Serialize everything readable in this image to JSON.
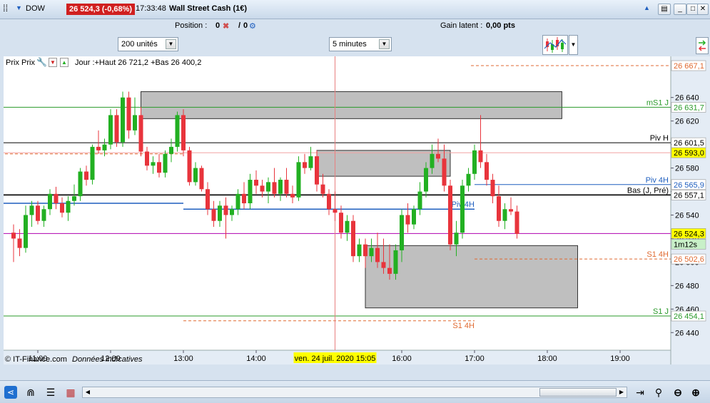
{
  "titlebar": {
    "symbol": "DOW",
    "price_badge": "26 524,3 (-0,68%)",
    "time": "17:33:48",
    "instrument": "Wall Street Cash (1€)"
  },
  "infobar": {
    "position_label": "Position :",
    "position_value": "0",
    "position_value2": "0",
    "gain_label": "Gain latent :",
    "gain_value": "0,00 pts"
  },
  "toolbar": {
    "units_value": "200 unités",
    "timeframe_value": "5 minutes"
  },
  "chart_header": {
    "label": "Prix Prix",
    "summary": "Jour :+Haut 26 721,2 +Bas 26 400,2"
  },
  "chart_footer": {
    "copyright": "© IT-Finance.com",
    "note": "Données indicatives"
  },
  "colors": {
    "up": "#22b022",
    "down": "#e8343c",
    "grid_bg": "#ffffff",
    "badge_red": "#d02020",
    "price_line": "#b000b0",
    "blue_level": "#1f5fbf",
    "green_level": "#2a9a2a",
    "orange_level": "#e06a30",
    "zone_fill": "#aaaaaa"
  },
  "chart_data": {
    "type": "candlestick",
    "ylim": [
      26425,
      26675
    ],
    "y_ticks": [
      26440,
      26460,
      26480,
      26500,
      26520,
      26540,
      26560,
      26580,
      26600,
      26620,
      26640
    ],
    "y_tick_labels": [
      "26 440",
      "26 460",
      "26 480",
      "26 500",
      "26 520",
      "26 540",
      "26 560",
      "26 580",
      "26 600",
      "26 620",
      "26 640"
    ],
    "x_ticks": [
      {
        "label": "11:00",
        "min": 660
      },
      {
        "label": "12:00",
        "min": 720
      },
      {
        "label": "13:00",
        "min": 780
      },
      {
        "label": "14:00",
        "min": 840
      },
      {
        "label": "16:00",
        "min": 960
      },
      {
        "label": "17:00",
        "min": 1020
      },
      {
        "label": "18:00",
        "min": 1080
      },
      {
        "label": "19:00",
        "min": 1140
      }
    ],
    "cursor": {
      "min": 905,
      "label": "ven. 24 juil. 2020 15:05"
    },
    "levels": [
      {
        "name": "mS1 J",
        "value": 26631.7,
        "label": "26 631,7",
        "color": "#2a9a2a",
        "from": 0,
        "dash": false,
        "badge_bg": "#ffffff",
        "badge_fg": "#2a9a2a"
      },
      {
        "name": "Piv H",
        "value": 26601.5,
        "label": "26 601,5",
        "color": "#000000",
        "from": 0,
        "dash": false,
        "badge_bg": "#ffffff",
        "badge_fg": "#000000"
      },
      {
        "name": "",
        "value": 26593.0,
        "label": "26 593,0",
        "color": "#f0a0a0",
        "from": 0,
        "dash": false,
        "badge_bg": "#ffff00",
        "badge_fg": "#000000"
      },
      {
        "name": "Piv 4H",
        "value": 26565.9,
        "label": "26 565,9",
        "color": "#1f5fbf",
        "from": 1020,
        "dash": false,
        "badge_bg": "#ffffff",
        "badge_fg": "#1f5fbf"
      },
      {
        "name": "Bas (J, Pré)",
        "value": 26557.1,
        "label": "26 557,1",
        "color": "#000000",
        "from": 0,
        "dash": false,
        "badge_bg": "#ffffff",
        "badge_fg": "#000000",
        "thick": true
      },
      {
        "name": "",
        "value": 26524.3,
        "label": "26 524,3",
        "color": "#b000b0",
        "from": 0,
        "dash": false,
        "badge_bg": "#ffff00",
        "badge_fg": "#000000"
      },
      {
        "name": "S1 4H",
        "value": 26502.6,
        "label": "26 502,6",
        "color": "#e06a30",
        "from": 1020,
        "dash": true,
        "badge_bg": "#ffffff",
        "badge_fg": "#e06a30"
      },
      {
        "name": "S1 J",
        "value": 26454.1,
        "label": "26 454,1",
        "color": "#2a9a2a",
        "from": 0,
        "dash": false,
        "badge_bg": "#ffffff",
        "badge_fg": "#2a9a2a"
      }
    ],
    "top_level": {
      "value": 26667.1,
      "label": "26 667,1"
    },
    "countdown": "1m12s",
    "segments": [
      {
        "name": "",
        "value": 26550,
        "from": 600,
        "to": 780,
        "color": "#1f5fbf"
      },
      {
        "name": "Piv 4H",
        "value": 26545,
        "from": 780,
        "to": 1020,
        "color": "#1f5fbf",
        "dash": false
      },
      {
        "name": "S1 4H",
        "value": 26450,
        "from": 780,
        "to": 1020,
        "color": "#e06a30",
        "dash": true
      },
      {
        "name": "",
        "value": 26592,
        "from": 600,
        "to": 780,
        "color": "#e06a30",
        "dash": true
      }
    ],
    "zones": [
      {
        "from": 745,
        "to": 1092,
        "top": 26645,
        "bottom": 26622
      },
      {
        "from": 890,
        "to": 1000,
        "top": 26595,
        "bottom": 26573
      },
      {
        "from": 930,
        "to": 1105,
        "top": 26514,
        "bottom": 26461
      }
    ],
    "candles": [
      {
        "t": 640,
        "o": 26525,
        "h": 26532,
        "l": 26500,
        "c": 26520
      },
      {
        "t": 645,
        "o": 26520,
        "h": 26528,
        "l": 26505,
        "c": 26512
      },
      {
        "t": 650,
        "o": 26512,
        "h": 26548,
        "l": 26508,
        "c": 26540
      },
      {
        "t": 655,
        "o": 26540,
        "h": 26552,
        "l": 26530,
        "c": 26548
      },
      {
        "t": 660,
        "o": 26548,
        "h": 26552,
        "l": 26532,
        "c": 26535
      },
      {
        "t": 665,
        "o": 26535,
        "h": 26548,
        "l": 26530,
        "c": 26545
      },
      {
        "t": 670,
        "o": 26545,
        "h": 26562,
        "l": 26540,
        "c": 26558
      },
      {
        "t": 675,
        "o": 26558,
        "h": 26564,
        "l": 26545,
        "c": 26550
      },
      {
        "t": 680,
        "o": 26550,
        "h": 26555,
        "l": 26538,
        "c": 26542
      },
      {
        "t": 685,
        "o": 26542,
        "h": 26556,
        "l": 26535,
        "c": 26552
      },
      {
        "t": 690,
        "o": 26552,
        "h": 26566,
        "l": 26548,
        "c": 26556
      },
      {
        "t": 695,
        "o": 26556,
        "h": 26580,
        "l": 26552,
        "c": 26577
      },
      {
        "t": 700,
        "o": 26577,
        "h": 26582,
        "l": 26565,
        "c": 26570
      },
      {
        "t": 705,
        "o": 26570,
        "h": 26600,
        "l": 26566,
        "c": 26598
      },
      {
        "t": 710,
        "o": 26598,
        "h": 26612,
        "l": 26592,
        "c": 26595
      },
      {
        "t": 715,
        "o": 26595,
        "h": 26605,
        "l": 26590,
        "c": 26600
      },
      {
        "t": 720,
        "o": 26600,
        "h": 26630,
        "l": 26596,
        "c": 26625
      },
      {
        "t": 725,
        "o": 26625,
        "h": 26630,
        "l": 26598,
        "c": 26602
      },
      {
        "t": 730,
        "o": 26602,
        "h": 26645,
        "l": 26598,
        "c": 26640
      },
      {
        "t": 735,
        "o": 26640,
        "h": 26645,
        "l": 26605,
        "c": 26612
      },
      {
        "t": 740,
        "o": 26612,
        "h": 26640,
        "l": 26608,
        "c": 26625
      },
      {
        "t": 745,
        "o": 26625,
        "h": 26632,
        "l": 26590,
        "c": 26594
      },
      {
        "t": 750,
        "o": 26594,
        "h": 26598,
        "l": 26578,
        "c": 26582
      },
      {
        "t": 755,
        "o": 26582,
        "h": 26590,
        "l": 26575,
        "c": 26585
      },
      {
        "t": 760,
        "o": 26585,
        "h": 26592,
        "l": 26572,
        "c": 26576
      },
      {
        "t": 765,
        "o": 26576,
        "h": 26595,
        "l": 26572,
        "c": 26592
      },
      {
        "t": 770,
        "o": 26592,
        "h": 26605,
        "l": 26585,
        "c": 26598
      },
      {
        "t": 775,
        "o": 26598,
        "h": 26628,
        "l": 26594,
        "c": 26625
      },
      {
        "t": 780,
        "o": 26625,
        "h": 26630,
        "l": 26590,
        "c": 26595
      },
      {
        "t": 785,
        "o": 26595,
        "h": 26598,
        "l": 26565,
        "c": 26568
      },
      {
        "t": 790,
        "o": 26568,
        "h": 26585,
        "l": 26565,
        "c": 26580
      },
      {
        "t": 795,
        "o": 26580,
        "h": 26582,
        "l": 26560,
        "c": 26562
      },
      {
        "t": 800,
        "o": 26562,
        "h": 26568,
        "l": 26540,
        "c": 26545
      },
      {
        "t": 805,
        "o": 26545,
        "h": 26552,
        "l": 26530,
        "c": 26535
      },
      {
        "t": 810,
        "o": 26535,
        "h": 26552,
        "l": 26530,
        "c": 26548
      },
      {
        "t": 815,
        "o": 26548,
        "h": 26555,
        "l": 26520,
        "c": 26540
      },
      {
        "t": 820,
        "o": 26540,
        "h": 26548,
        "l": 26535,
        "c": 26545
      },
      {
        "t": 825,
        "o": 26545,
        "h": 26562,
        "l": 26540,
        "c": 26558
      },
      {
        "t": 830,
        "o": 26558,
        "h": 26568,
        "l": 26545,
        "c": 26550
      },
      {
        "t": 835,
        "o": 26550,
        "h": 26575,
        "l": 26545,
        "c": 26570
      },
      {
        "t": 840,
        "o": 26570,
        "h": 26578,
        "l": 26558,
        "c": 26565
      },
      {
        "t": 845,
        "o": 26565,
        "h": 26570,
        "l": 26555,
        "c": 26560
      },
      {
        "t": 850,
        "o": 26560,
        "h": 26572,
        "l": 26550,
        "c": 26568
      },
      {
        "t": 855,
        "o": 26568,
        "h": 26580,
        "l": 26555,
        "c": 26558
      },
      {
        "t": 860,
        "o": 26558,
        "h": 26572,
        "l": 26552,
        "c": 26570
      },
      {
        "t": 865,
        "o": 26570,
        "h": 26580,
        "l": 26555,
        "c": 26558
      },
      {
        "t": 870,
        "o": 26558,
        "h": 26565,
        "l": 26550,
        "c": 26555
      },
      {
        "t": 875,
        "o": 26555,
        "h": 26590,
        "l": 26552,
        "c": 26585
      },
      {
        "t": 880,
        "o": 26585,
        "h": 26592,
        "l": 26575,
        "c": 26580
      },
      {
        "t": 885,
        "o": 26580,
        "h": 26598,
        "l": 26578,
        "c": 26590
      },
      {
        "t": 890,
        "o": 26590,
        "h": 26595,
        "l": 26560,
        "c": 26566
      },
      {
        "t": 895,
        "o": 26566,
        "h": 26575,
        "l": 26555,
        "c": 26558
      },
      {
        "t": 900,
        "o": 26558,
        "h": 26562,
        "l": 26540,
        "c": 26545
      },
      {
        "t": 905,
        "o": 26545,
        "h": 26560,
        "l": 26535,
        "c": 26542
      },
      {
        "t": 910,
        "o": 26542,
        "h": 26548,
        "l": 26520,
        "c": 26525
      },
      {
        "t": 915,
        "o": 26525,
        "h": 26540,
        "l": 26518,
        "c": 26535
      },
      {
        "t": 920,
        "o": 26535,
        "h": 26540,
        "l": 26500,
        "c": 26505
      },
      {
        "t": 925,
        "o": 26505,
        "h": 26520,
        "l": 26500,
        "c": 26515
      },
      {
        "t": 930,
        "o": 26515,
        "h": 26520,
        "l": 26495,
        "c": 26505
      },
      {
        "t": 935,
        "o": 26505,
        "h": 26520,
        "l": 26500,
        "c": 26512
      },
      {
        "t": 940,
        "o": 26512,
        "h": 26525,
        "l": 26495,
        "c": 26500
      },
      {
        "t": 945,
        "o": 26500,
        "h": 26520,
        "l": 26490,
        "c": 26495
      },
      {
        "t": 950,
        "o": 26495,
        "h": 26515,
        "l": 26485,
        "c": 26490
      },
      {
        "t": 955,
        "o": 26490,
        "h": 26515,
        "l": 26485,
        "c": 26510
      },
      {
        "t": 960,
        "o": 26510,
        "h": 26545,
        "l": 26500,
        "c": 26540
      },
      {
        "t": 965,
        "o": 26540,
        "h": 26550,
        "l": 26525,
        "c": 26532
      },
      {
        "t": 970,
        "o": 26532,
        "h": 26548,
        "l": 26528,
        "c": 26545
      },
      {
        "t": 975,
        "o": 26545,
        "h": 26568,
        "l": 26540,
        "c": 26560
      },
      {
        "t": 980,
        "o": 26560,
        "h": 26585,
        "l": 26555,
        "c": 26580
      },
      {
        "t": 985,
        "o": 26580,
        "h": 26600,
        "l": 26575,
        "c": 26592
      },
      {
        "t": 990,
        "o": 26592,
        "h": 26605,
        "l": 26585,
        "c": 26588
      },
      {
        "t": 995,
        "o": 26588,
        "h": 26600,
        "l": 26560,
        "c": 26565
      },
      {
        "t": 1000,
        "o": 26565,
        "h": 26570,
        "l": 26510,
        "c": 26515
      },
      {
        "t": 1005,
        "o": 26515,
        "h": 26535,
        "l": 26505,
        "c": 26525
      },
      {
        "t": 1010,
        "o": 26525,
        "h": 26570,
        "l": 26520,
        "c": 26565
      },
      {
        "t": 1015,
        "o": 26565,
        "h": 26580,
        "l": 26560,
        "c": 26575
      },
      {
        "t": 1020,
        "o": 26575,
        "h": 26600,
        "l": 26570,
        "c": 26595
      },
      {
        "t": 1025,
        "o": 26595,
        "h": 26625,
        "l": 26580,
        "c": 26585
      },
      {
        "t": 1030,
        "o": 26585,
        "h": 26592,
        "l": 26565,
        "c": 26570
      },
      {
        "t": 1035,
        "o": 26570,
        "h": 26575,
        "l": 26550,
        "c": 26556
      },
      {
        "t": 1040,
        "o": 26556,
        "h": 26565,
        "l": 26530,
        "c": 26535
      },
      {
        "t": 1045,
        "o": 26535,
        "h": 26550,
        "l": 26528,
        "c": 26545
      },
      {
        "t": 1050,
        "o": 26545,
        "h": 26555,
        "l": 26540,
        "c": 26543
      },
      {
        "t": 1055,
        "o": 26543,
        "h": 26548,
        "l": 26520,
        "c": 26524
      }
    ]
  }
}
